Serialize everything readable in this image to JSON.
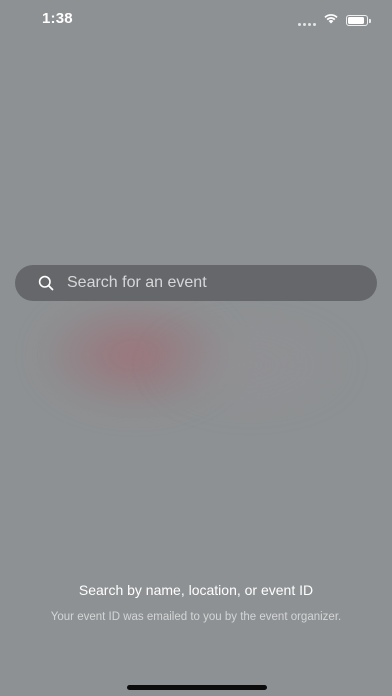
{
  "status_bar": {
    "time": "1:38",
    "icons": [
      "signal-dots-icon",
      "wifi-icon",
      "battery-icon"
    ]
  },
  "search": {
    "placeholder": "Search for an event",
    "value": "",
    "icon": "search-icon"
  },
  "hint": {
    "title": "Search by name, location, or event ID",
    "subtitle": "Your event ID was emailed to you by the event organizer."
  },
  "colors": {
    "background": "#8e9193",
    "search_bar": "#65676a",
    "text_primary": "#ffffff",
    "text_secondary": "#d3d5d7"
  }
}
